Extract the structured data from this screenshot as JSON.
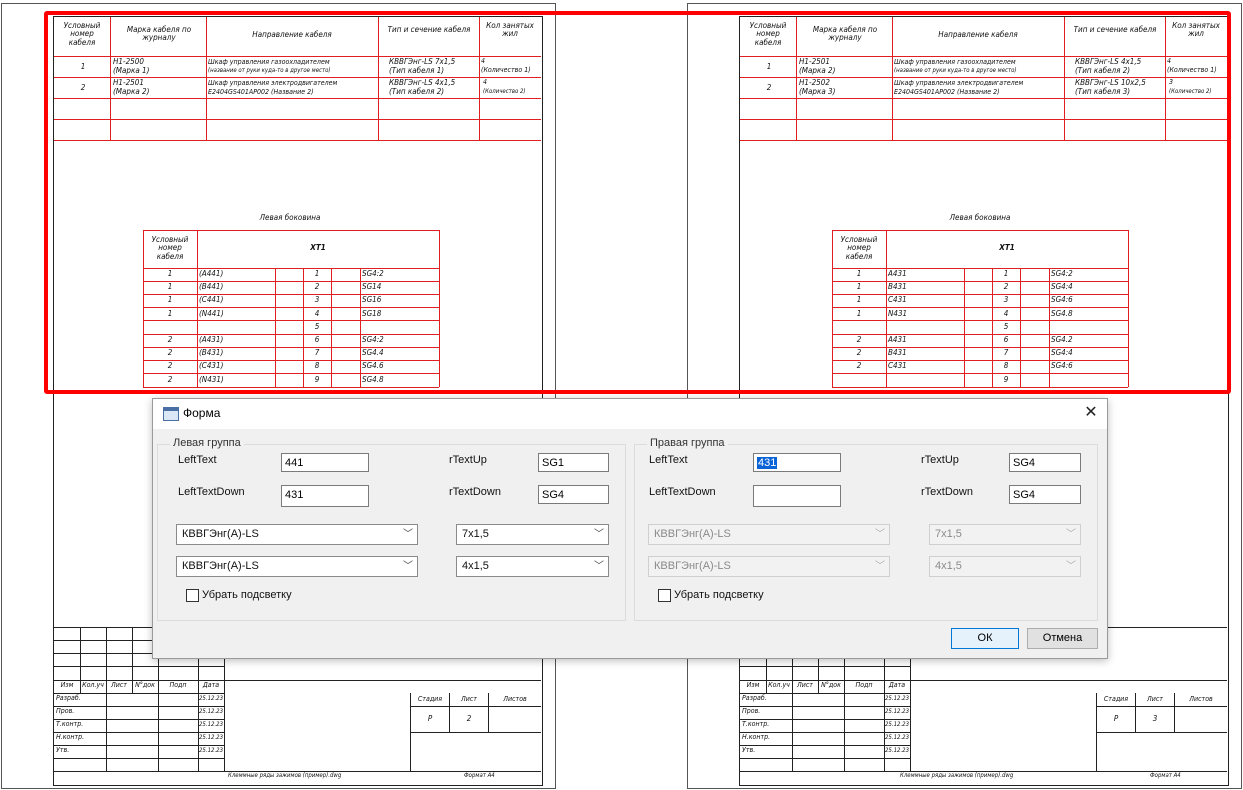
{
  "left_sheet": {
    "headers": [
      "Условный номер кабеля",
      "Марка кабеля по журналу",
      "Направление кабеля",
      "Тип и сечение кабеля",
      "Кол занятых жил"
    ],
    "rows": [
      [
        "1",
        "Н1-2500",
        "(Маркa 1)",
        "Шкаф управления газоохладителем",
        "(название от руки куда-то в другое место)",
        "КВВГЭнг-LS 7х1,5",
        "(Тип кабеля 1)",
        "4",
        "(Количество 1)"
      ],
      [
        "2",
        "Н1-2501",
        "(Маркa 2)",
        "Шкаф управления электродвигателем",
        "E2404GS401AP002 (Название 2)",
        "КВВГЭнг-LS 4х1,5",
        "(Тип кабеля 2)",
        "4",
        "(Количество 2)"
      ]
    ],
    "side_title": "Левая боковина",
    "terminal_header": "XT1",
    "terminal_col": "Условный номер кабеля",
    "terminals": [
      [
        "1",
        "(A441)",
        "1",
        "SG4:2"
      ],
      [
        "1",
        "(B441)",
        "2",
        "SG14"
      ],
      [
        "1",
        "(C441)",
        "3",
        "SG16"
      ],
      [
        "1",
        "(N441)",
        "4",
        "SG18"
      ],
      [
        "",
        "",
        "5",
        ""
      ],
      [
        "2",
        "(A431)",
        "6",
        "SG4:2"
      ],
      [
        "2",
        "(B431)",
        "7",
        "SG4.4"
      ],
      [
        "2",
        "(C431)",
        "8",
        "SG4.6"
      ],
      [
        "2",
        "(N431)",
        "9",
        "SG4.8"
      ]
    ],
    "stamp_labels": [
      "Изм",
      "Кол.уч",
      "Лист",
      "N°док",
      "Подп",
      "Дата"
    ],
    "stamp_rows": [
      "Разраб.",
      "Пров.",
      "Т.контр.",
      "Н.контр.",
      "Утв."
    ],
    "stamp_date": "25.12.23",
    "stage_labels": [
      "Стадия",
      "Лист",
      "Листов"
    ],
    "stage_value": "Р",
    "sheet_no": "2",
    "footer_file": "Клеммные ряды зажимов (пример).dwg",
    "footer_format": "Формат А4"
  },
  "right_sheet": {
    "headers": [
      "Условный номер кабеля",
      "Марка кабеля по журналу",
      "Направление кабеля",
      "Тип и сечение кабеля",
      "Кол занятых жил"
    ],
    "rows": [
      [
        "1",
        "Н1-2501",
        "(Маркa 2)",
        "Шкаф управления газоохладителем",
        "(название от руки куда-то в другое место)",
        "КВВГЭнг-LS 4х1,5",
        "(Тип кабеля 2)",
        "4",
        "(Количество 1)"
      ],
      [
        "2",
        "Н1-2502",
        "(Маркa 3)",
        "Шкаф управления электродвигателем",
        "E2404GS401AP002 (Название 2)",
        "КВВГЭнг-LS 10х2,5",
        "(Тип кабеля 3)",
        "3",
        "(Количество 2)"
      ]
    ],
    "side_title": "Левая боковина",
    "terminal_header": "XT1",
    "terminal_col": "Условный номер кабеля",
    "terminals": [
      [
        "1",
        "A431",
        "1",
        "SG4:2"
      ],
      [
        "1",
        "B431",
        "2",
        "SG4:4"
      ],
      [
        "1",
        "C431",
        "3",
        "SG4:6"
      ],
      [
        "1",
        "N431",
        "4",
        "SG4.8"
      ],
      [
        "",
        "",
        "5",
        ""
      ],
      [
        "2",
        "A431",
        "6",
        "SG4.2"
      ],
      [
        "2",
        "B431",
        "7",
        "SG4:4"
      ],
      [
        "2",
        "C431",
        "8",
        "SG4:6"
      ],
      [
        "",
        "",
        "9",
        ""
      ]
    ],
    "stamp_labels": [
      "Изм",
      "Кол.уч",
      "Лист",
      "N°док",
      "Подп",
      "Дата"
    ],
    "stamp_rows": [
      "Разраб.",
      "Пров.",
      "Т.контр.",
      "Н.контр.",
      "Утв."
    ],
    "stamp_date": "25.12.23",
    "stage_labels": [
      "Стадия",
      "Лист",
      "Листов"
    ],
    "stage_value": "Р",
    "sheet_no": "3",
    "footer_file": "Клеммные ряды зажимов (пример).dwg",
    "footer_format": "Формат А4"
  },
  "dialog": {
    "title": "Форма",
    "close_icon": "close-icon",
    "left_group": {
      "title": "Левая группа",
      "left_text_label": "LeftText",
      "left_text_value": "441",
      "left_text_down_label": "LeftTextDown",
      "left_text_down_value": "431",
      "r_text_up_label": "rTextUp",
      "r_text_up_value": "SG1",
      "r_text_down_label": "rTextDown",
      "r_text_down_value": "SG4",
      "cable_type_1": "КВВГЭнг(А)-LS",
      "cable_section_1": "7x1,5",
      "cable_type_2": "КВВГЭнг(А)-LS",
      "cable_section_2": "4x1,5",
      "checkbox_label": "Убрать подсветку"
    },
    "right_group": {
      "title": "Правая группа",
      "left_text_label": "LeftText",
      "left_text_value": "431",
      "left_text_down_label": "LeftTextDown",
      "left_text_down_value": "",
      "r_text_up_label": "rTextUp",
      "r_text_up_value": "SG4",
      "r_text_down_label": "rTextDown",
      "r_text_down_value": "SG4",
      "cable_type_1": "КВВГЭнг(А)-LS",
      "cable_section_1": "7x1,5",
      "cable_type_2": "КВВГЭнг(А)-LS",
      "cable_section_2": "4x1,5",
      "checkbox_label": "Убрать подсветку"
    },
    "ok_label": "ОК",
    "cancel_label": "Отмена"
  },
  "colors": {
    "highlight": "#ff0000",
    "table_lines": "#e02020",
    "selection": "#0a64d8"
  }
}
